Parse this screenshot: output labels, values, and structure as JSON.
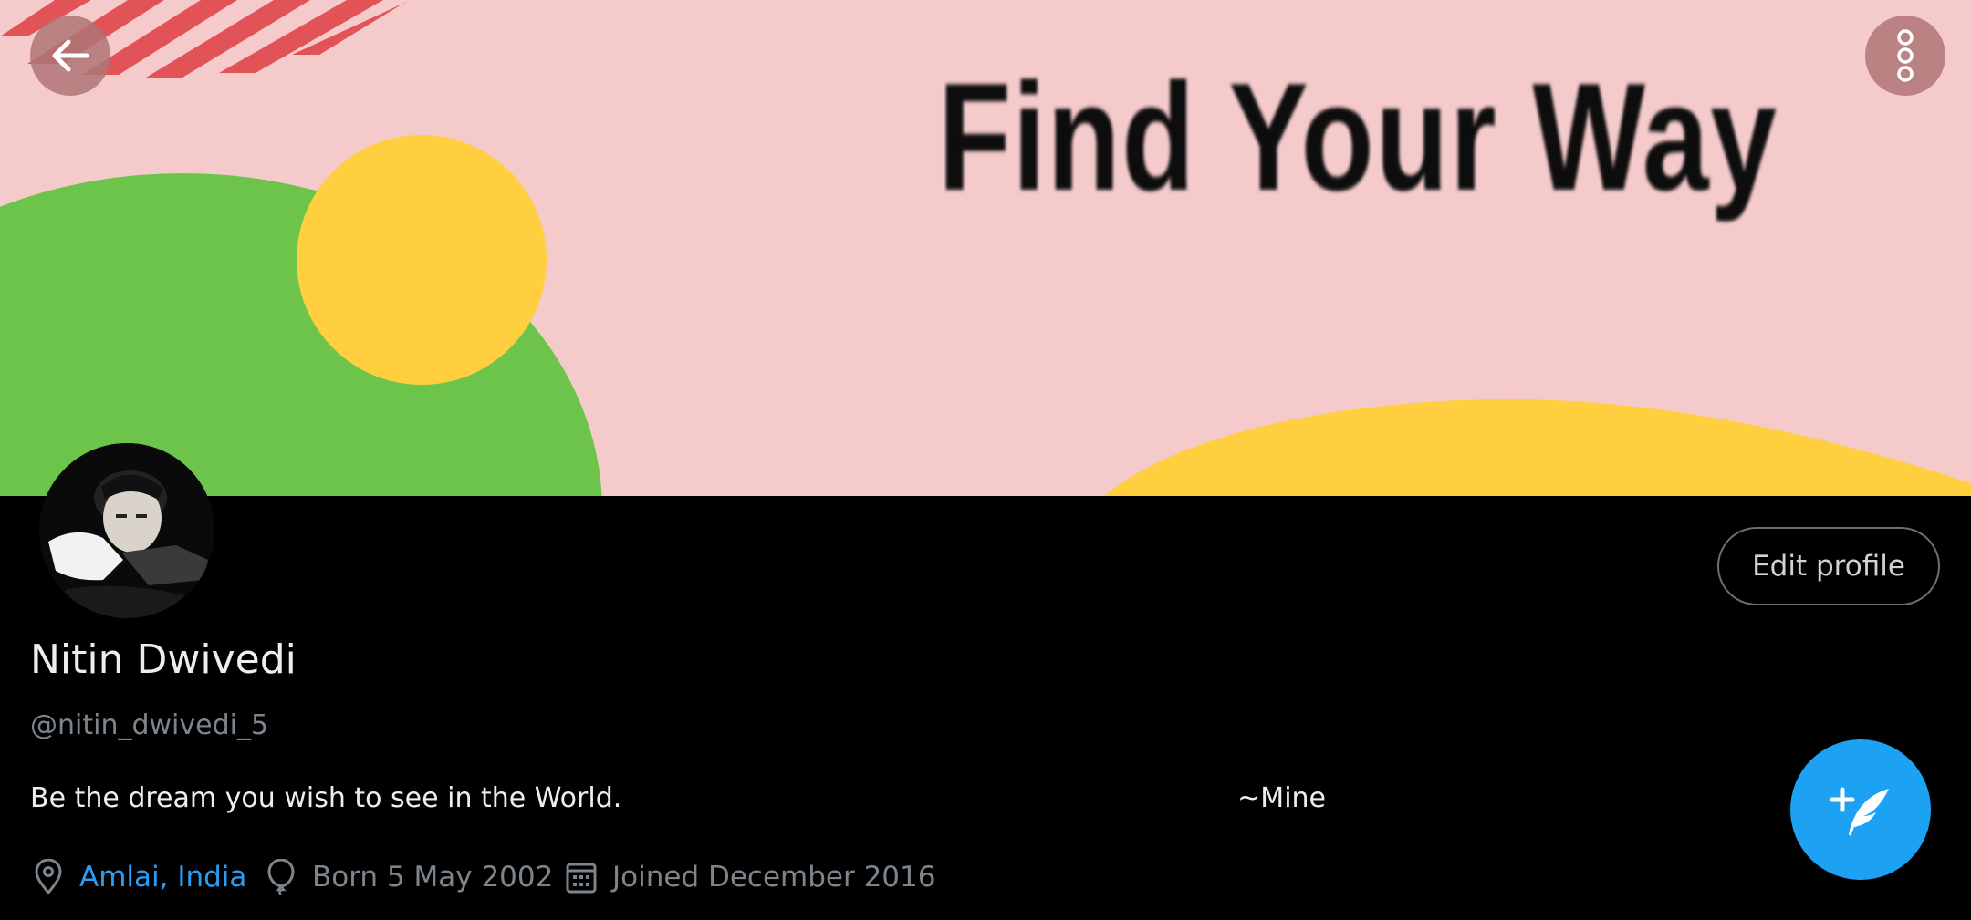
{
  "banner": {
    "text": "Find Your Way",
    "colors": {
      "background": "#f5cacb",
      "green": "#6cc54a",
      "yellow": "#ffcf40",
      "stripes": "#e0474c"
    }
  },
  "header": {
    "back_icon": "arrow-left-icon",
    "more_icon": "more-vertical-icon"
  },
  "profile": {
    "name": "Nitin Dwivedi",
    "handle": "@nitin_dwivedi_5",
    "bio": "Be the dream you wish to see in the World.",
    "bio_signature": "~Mine",
    "edit_label": "Edit profile",
    "location": "Amlai, India",
    "born": "Born 5 May 2002",
    "joined": "Joined December 2016"
  },
  "fab": {
    "icon": "compose-tweet-icon"
  },
  "colors": {
    "accent": "#1da1f2",
    "background": "#000000",
    "secondary_text": "#7d858c"
  }
}
